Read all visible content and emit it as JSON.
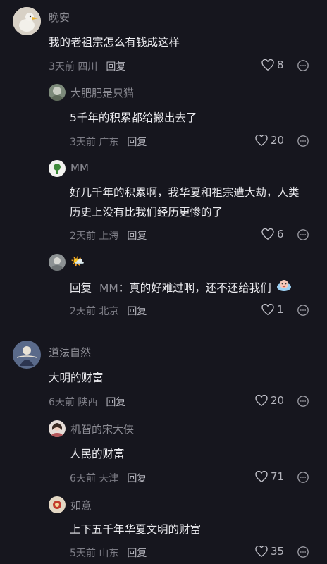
{
  "comments": [
    {
      "name": "晚安",
      "text": "我的老祖宗怎么有钱成这样",
      "time": "3天前 四川",
      "reply": "回复",
      "likes": "8"
    },
    {
      "name": "大肥肥是只猫",
      "text": "5千年的积累都给搬出去了",
      "time": "3天前 广东",
      "reply": "回复",
      "likes": "20"
    },
    {
      "name": "MM",
      "text_lines": [
        "好几千年的积累啊，我华夏和祖宗遭大劫，人类",
        "历史上没有比我们经历更惨的了"
      ],
      "time": "2天前 上海",
      "reply": "回复",
      "likes": "6"
    },
    {
      "name": "🌤️",
      "reply_prefix": "回复",
      "reply_to": "MM",
      "text": "：真的好难过啊，还不还给我们",
      "time": "2天前 北京",
      "reply": "回复",
      "likes": "1"
    },
    {
      "name": "道法自然",
      "text": "大明的财富",
      "time": "6天前 陕西",
      "reply": "回复",
      "likes": "20"
    },
    {
      "name": "机智的宋大侠",
      "text": "人民的财富",
      "time": "6天前 天津",
      "reply": "回复",
      "likes": "71"
    },
    {
      "name": "如意",
      "text": "上下五千年华夏文明的财富",
      "time": "5天前 山东",
      "reply": "回复",
      "likes": "35"
    }
  ],
  "icons": {
    "like": "heart-outline-icon",
    "more": "more-options-icon"
  }
}
